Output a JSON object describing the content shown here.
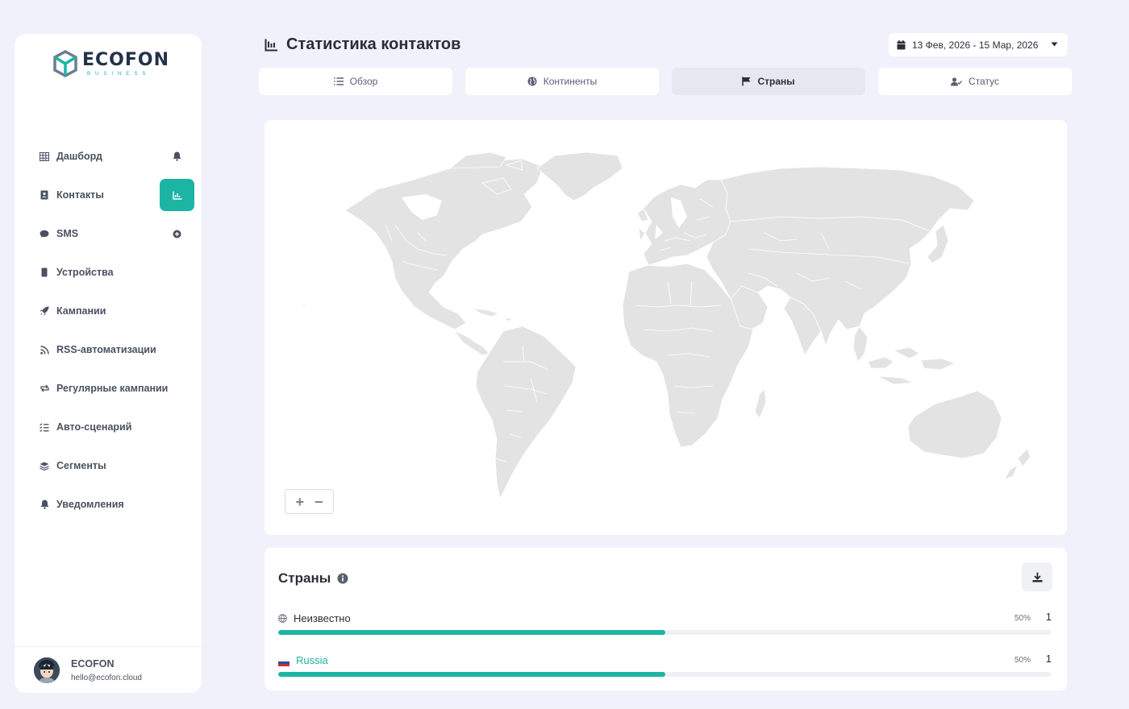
{
  "brand": {
    "name": "ECOFON",
    "tagline": "BUSINESS",
    "accent": "#1cb5a3"
  },
  "sidebar": {
    "items": [
      {
        "label": "Дашборд",
        "icon": "table-icon",
        "right_icon": "bell-icon"
      },
      {
        "label": "Контакты",
        "icon": "address-book-icon",
        "right_icon": "chart-icon",
        "active": true
      },
      {
        "label": "SMS",
        "icon": "chat-icon",
        "right_icon": "plus-circle-icon"
      },
      {
        "label": "Устройства",
        "icon": "phone-icon"
      },
      {
        "label": "Кампании",
        "icon": "rocket-icon"
      },
      {
        "label": "RSS-автоматизации",
        "icon": "rss-icon"
      },
      {
        "label": "Регулярные кампании",
        "icon": "repeat-icon"
      },
      {
        "label": "Авто-сценарий",
        "icon": "list-check-icon"
      },
      {
        "label": "Сегменты",
        "icon": "layers-icon"
      },
      {
        "label": "Уведомления",
        "icon": "bell-icon"
      }
    ],
    "user": {
      "name": "ECOFON",
      "email": "hello@ecofon.cloud"
    }
  },
  "header": {
    "title": "Статистика контактов",
    "date_range": "13 Фев, 2026 - 15 Мар, 2026"
  },
  "tabs": [
    {
      "label": "Обзор",
      "icon": "list-icon"
    },
    {
      "label": "Континенты",
      "icon": "globe-icon"
    },
    {
      "label": "Страны",
      "icon": "flag-icon",
      "active": true
    },
    {
      "label": "Статус",
      "icon": "user-check-icon"
    }
  ],
  "map": {
    "zoom_in": "+",
    "zoom_out": "−",
    "land_color": "#e3e3e3",
    "border_color": "#ffffff"
  },
  "countries": {
    "title": "Страны",
    "rows": [
      {
        "name": "Неизвестно",
        "icon": "globe-icon",
        "percent": "50%",
        "percent_value": 0.5,
        "count": "1"
      },
      {
        "name": "Russia",
        "icon": "russia-flag-icon",
        "percent": "50%",
        "percent_value": 0.5,
        "count": "1"
      }
    ]
  }
}
